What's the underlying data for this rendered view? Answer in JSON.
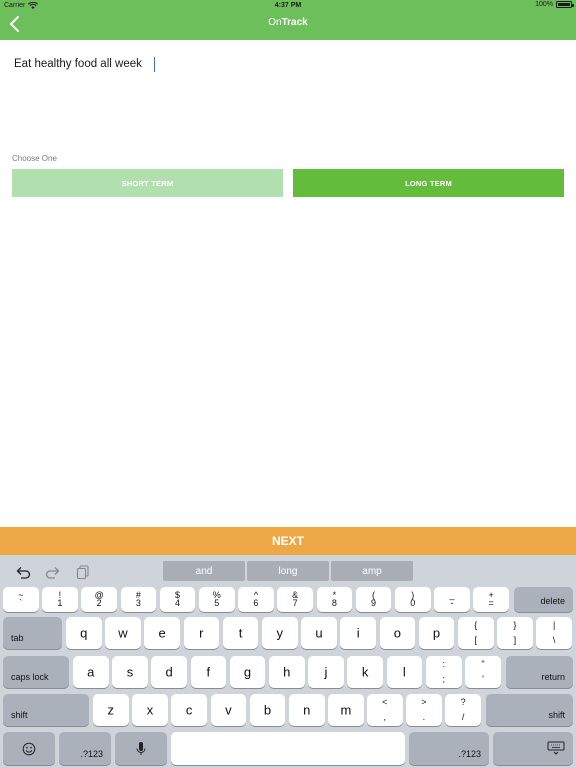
{
  "status_bar": {
    "carrier": "Carrier",
    "time": "4:37 PM",
    "battery": "100%",
    "battery_level": 1.0
  },
  "nav": {
    "brand_part1": "On",
    "brand_part2": "Track",
    "back_icon": "chevron-left-icon"
  },
  "goal": {
    "text": "Eat healthy food all week"
  },
  "choice": {
    "label": "Choose One",
    "short_term": "SHORT TERM",
    "long_term": "LONG TERM"
  },
  "next": {
    "label": "NEXT"
  },
  "colors": {
    "brand_green": "#6cbf5a",
    "selected_green": "#63bc3a",
    "unselected_green": "#b1dfad",
    "next_orange": "#eda744"
  },
  "keyboard": {
    "toolbar_icons": [
      "undo-icon",
      "redo-icon",
      "paste-icon"
    ],
    "suggestions": [
      "and",
      "long",
      "amp"
    ],
    "row1": [
      {
        "up": "~",
        "down": "`"
      },
      {
        "up": "!",
        "down": "1"
      },
      {
        "up": "@",
        "down": "2"
      },
      {
        "up": "#",
        "down": "3"
      },
      {
        "up": "$",
        "down": "4"
      },
      {
        "up": "%",
        "down": "5"
      },
      {
        "up": "^",
        "down": "6"
      },
      {
        "up": "&",
        "down": "7"
      },
      {
        "up": "*",
        "down": "8"
      },
      {
        "up": "(",
        "down": "9"
      },
      {
        "up": ")",
        "down": "0"
      },
      {
        "up": "_",
        "down": "-"
      },
      {
        "up": "+",
        "down": "="
      }
    ],
    "delete": "delete",
    "tab": "tab",
    "row2": [
      "q",
      "w",
      "e",
      "r",
      "t",
      "y",
      "u",
      "i",
      "o",
      "p"
    ],
    "row2_sym": [
      {
        "up": "{",
        "down": "["
      },
      {
        "up": "}",
        "down": "]"
      },
      {
        "up": "|",
        "down": "\\"
      }
    ],
    "caps_lock": "caps lock",
    "row3": [
      "a",
      "s",
      "d",
      "f",
      "g",
      "h",
      "j",
      "k",
      "l"
    ],
    "row3_sym": [
      {
        "up": ":",
        "down": ";"
      },
      {
        "up": "\"",
        "down": "'"
      }
    ],
    "return": "return",
    "shift": "shift",
    "row4": [
      "z",
      "x",
      "c",
      "v",
      "b",
      "n",
      "m"
    ],
    "row4_sym": [
      {
        "up": "<",
        "down": ","
      },
      {
        "up": ">",
        "down": "."
      },
      {
        "up": "?",
        "down": "/"
      }
    ],
    "numbers_key": ".?123",
    "bottom_icons": [
      "emoji-icon",
      "microphone-icon",
      "keyboard-dismiss-icon"
    ]
  }
}
